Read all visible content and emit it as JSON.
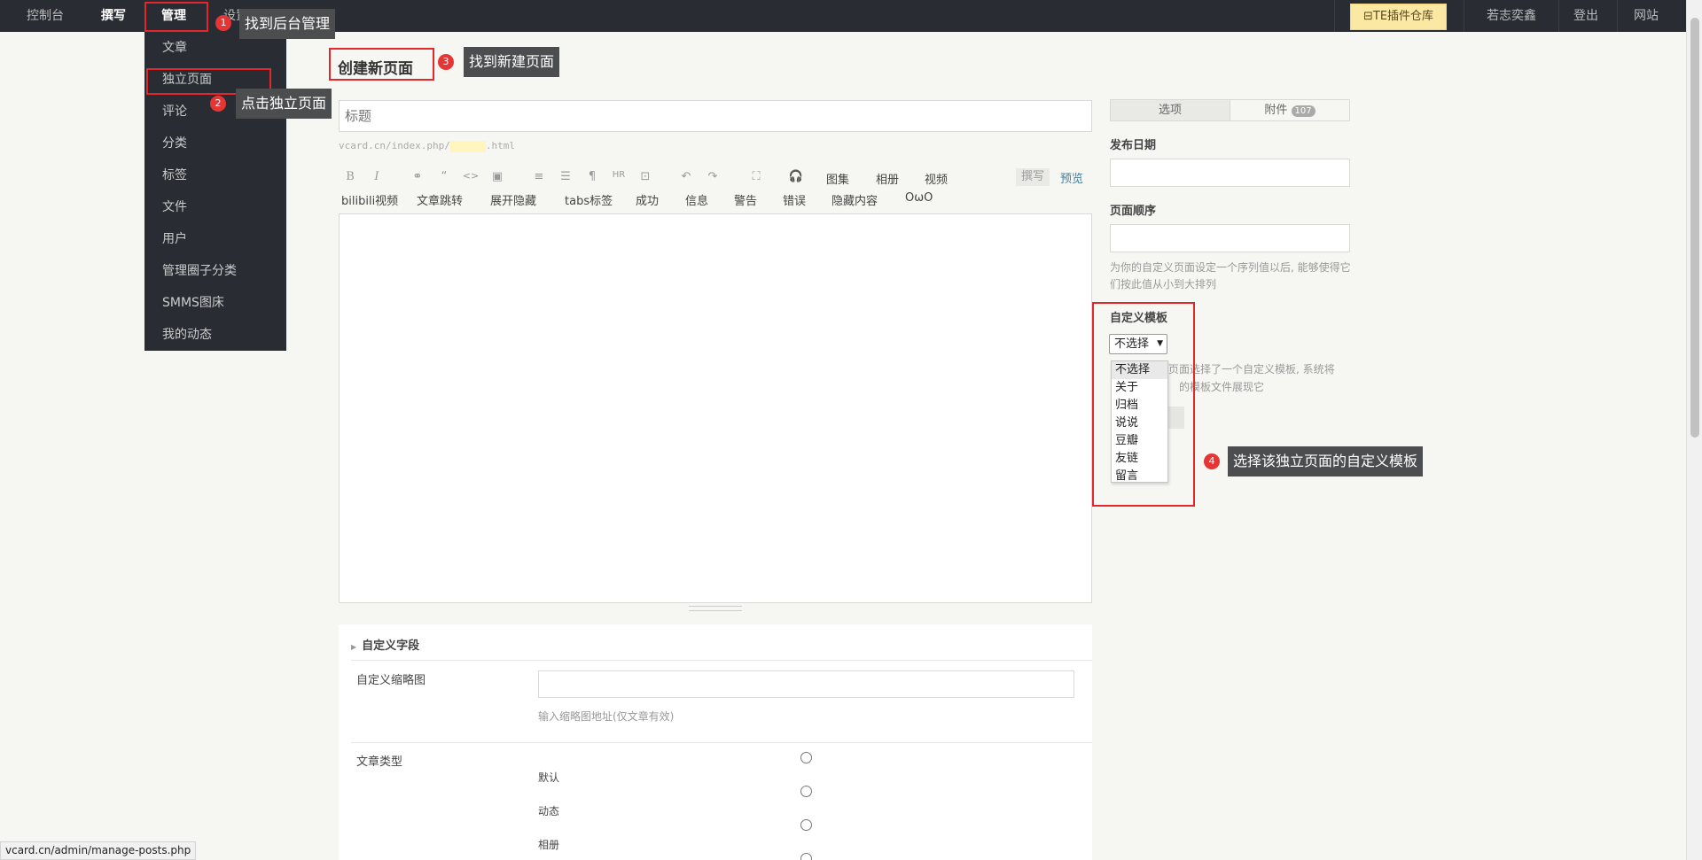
{
  "topbar": {
    "nav": [
      "控制台",
      "撰写",
      "管理",
      "设置"
    ],
    "plugin_store": "TE插件仓库",
    "user": "若志奕鑫",
    "logout": "登出",
    "site": "网站"
  },
  "manage_menu": [
    "文章",
    "独立页面",
    "评论",
    "分类",
    "标签",
    "文件",
    "用户",
    "管理圈子分类",
    "SMMS图床",
    "我的动态"
  ],
  "annotations": [
    {
      "num": "1",
      "text": "找到后台管理"
    },
    {
      "num": "2",
      "text": "点击独立页面"
    },
    {
      "num": "3",
      "text": "找到新建页面"
    },
    {
      "num": "4",
      "text": "选择该独立页面的自定义模板"
    }
  ],
  "main": {
    "title": "创建新页面",
    "title_placeholder": "标题",
    "slug_prefix": "vcard.cn/index.php/",
    "slug_suffix": ".html",
    "toolbar_icons": [
      "B",
      "I",
      "⚭",
      "“",
      "<>",
      "▣",
      "≡",
      "☰",
      "¶",
      "HR",
      "⊡",
      "↶",
      "↷",
      "⛶",
      "🎧"
    ],
    "toolbar_row1": [
      "图集",
      "相册",
      "视频"
    ],
    "toolbar_row2": [
      "bilibili视频",
      "文章跳转",
      "展开隐藏",
      "tabs标签",
      "成功",
      "信息",
      "警告",
      "错误",
      "隐藏内容",
      "OωO"
    ],
    "write": "撰写",
    "preview": "预览"
  },
  "custom_fields": {
    "heading": "自定义字段",
    "thumb_label": "自定义缩略图",
    "thumb_hint": "输入缩略图地址(仅文章有效)",
    "type_label": "文章类型",
    "type_options": [
      "默认",
      "动态",
      "相册"
    ]
  },
  "sidebar": {
    "tab_options": "选项",
    "tab_attach": "附件",
    "attach_count": "107",
    "publish_date": "发布日期",
    "page_order": "页面顺序",
    "order_hint": "为你的自定义页面设定一个序列值以后, 能够使得它们按此值从小到大排列",
    "custom_template": "自定义模板",
    "template_selected": "不选择",
    "template_hint_partial": "页面选择了一个自定义模板, 系统将",
    "template_hint_partial2": "的模板文件展现它",
    "template_options": [
      "不选择",
      "关于",
      "归档",
      "说说",
      "豆瓣",
      "友链",
      "留言"
    ]
  },
  "statusbar": "vcard.cn/admin/manage-posts.php",
  "colors": {
    "topbar": "#292d33",
    "highlight": "#e3272a",
    "badge": "#e63535",
    "tooltip": "#4b4d4f",
    "link": "#467b96"
  }
}
